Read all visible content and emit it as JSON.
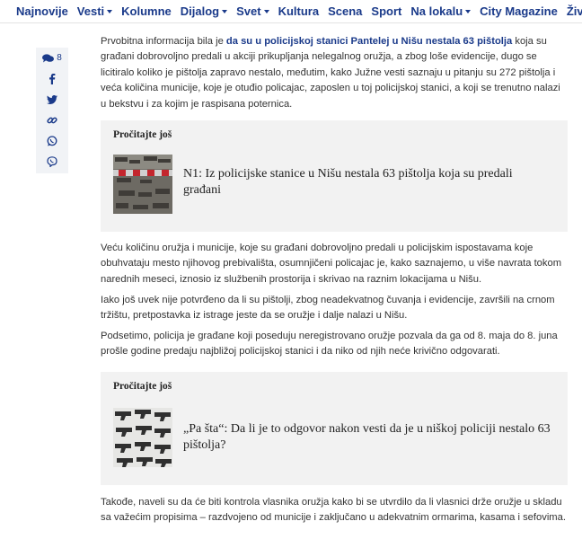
{
  "nav": {
    "items": [
      {
        "label": "Najnovije",
        "dropdown": false
      },
      {
        "label": "Vesti",
        "dropdown": true
      },
      {
        "label": "Kolumne",
        "dropdown": false
      },
      {
        "label": "Dijalog",
        "dropdown": true
      },
      {
        "label": "Svet",
        "dropdown": true
      },
      {
        "label": "Kultura",
        "dropdown": false
      },
      {
        "label": "Scena",
        "dropdown": false
      },
      {
        "label": "Sport",
        "dropdown": false
      },
      {
        "label": "Na lokalu",
        "dropdown": true
      },
      {
        "label": "City Magazine",
        "dropdown": false
      },
      {
        "label": "Život",
        "dropdown": false
      }
    ]
  },
  "share": {
    "comment_count": "8",
    "icons": [
      "comment-icon",
      "facebook-icon",
      "twitter-icon",
      "link-icon",
      "whatsapp-icon",
      "viber-icon"
    ]
  },
  "article": {
    "p1_before": "Prvobitna informacija bila je ",
    "p1_link": "da su u policijskoj stanici Pantelej u Nišu nestala 63 pištolja",
    "p1_after": " koja su građani dobrovoljno predali u akciji prikupljanja nelegalnog oružja, a zbog loše evidencije, dugo se licitiralo koliko je pištolja zapravo nestalo, međutim, kako Južne vesti saznaju u pitanju su 272 pištolja i veća količina municije, koje je otuđio policajac, zaposlen u toj policijskoj stanici, a koji se trenutno nalazi u bekstvu i za kojim je raspisana poternica.",
    "p2": "Veću količinu oružja i municije, koje su građani dobrovoljno predali u policijskim ispostavama koje obuhvataju mesto njihovog prebivališta, osumnjičeni policajac je, kako saznajemo, u više navrata tokom narednih meseci, iznosio iz službenih prostorija i skrivao na raznim lokacijama u Nišu.",
    "p3": "Iako još uvek nije potvrđeno da li su pištolji, zbog neadekvatnog čuvanja i evidencije, završili na crnom tržištu, pretpostavka iz istrage jeste da se oružje i dalje nalazi u Nišu.",
    "p4": "Podsetimo, policija je građane koji poseduju neregistrovano oružje pozvala da ga od 8. maja do 8. juna prošle godine predaju najbližoj policijskoj stanici i da niko od njih neće krivično odgovarati.",
    "p5": "Takođe, naveli su da će biti kontrola vlasnika oružja kako bi se utvrdilo da li vlasnici drže oružje u skladu sa važećim propisima – razdvojeno od municije i zaključano u adekvatnim ormarima, kasama i sefovima."
  },
  "related": [
    {
      "heading": "Pročitajte još",
      "title": "N1: Iz policijske stanice u Nišu nestala 63 pištolja koja su predali građani"
    },
    {
      "heading": "Pročitajte još",
      "title": "„Pa šta“: Da li je to odgovor nakon vesti da je u niškoj policiji nestalo 63 pištolja?"
    }
  ],
  "colors": {
    "brand": "#1a3a8a",
    "panel": "#f2f2f2",
    "share_bg": "#f1f3f6"
  }
}
